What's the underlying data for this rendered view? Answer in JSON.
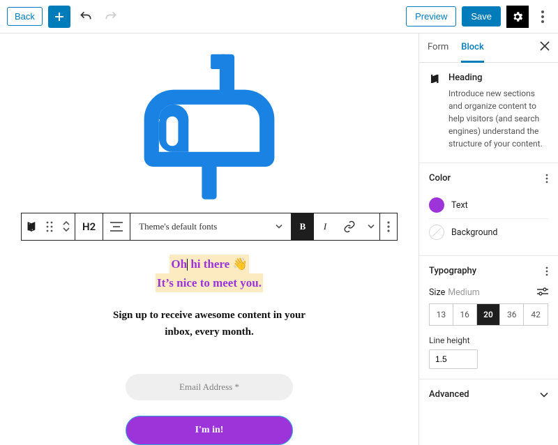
{
  "toolbar": {
    "back": "Back",
    "preview": "Preview",
    "save": "Save"
  },
  "canvas": {
    "block_toolbar": {
      "heading_level": "H2",
      "font": "Theme's default fonts",
      "bold": "B",
      "italic": "I"
    },
    "heading": {
      "line1_before_caret": "Oh",
      "line1_after_caret": " hi there ",
      "emoji": "👋",
      "line2": "It’s nice to meet you."
    },
    "subheading": "Sign up to receive awesome content in your inbox, every month.",
    "email_placeholder": "Email Address *",
    "submit_label": "I'm in!"
  },
  "sidebar": {
    "tabs": {
      "form": "Form",
      "block": "Block"
    },
    "block": {
      "title": "Heading",
      "description": "Introduce new sections and organize content to help visitors (and search engines) understand the structure of your content."
    },
    "color": {
      "title": "Color",
      "text_label": "Text",
      "bg_label": "Background",
      "text_hex": "#9d34da"
    },
    "typography": {
      "title": "Typography",
      "size_label": "Size",
      "size_preset": "Medium",
      "sizes": [
        "13",
        "16",
        "20",
        "36",
        "42"
      ],
      "selected_size": "20",
      "line_height_label": "Line height",
      "line_height": "1.5"
    },
    "advanced": {
      "title": "Advanced"
    }
  }
}
